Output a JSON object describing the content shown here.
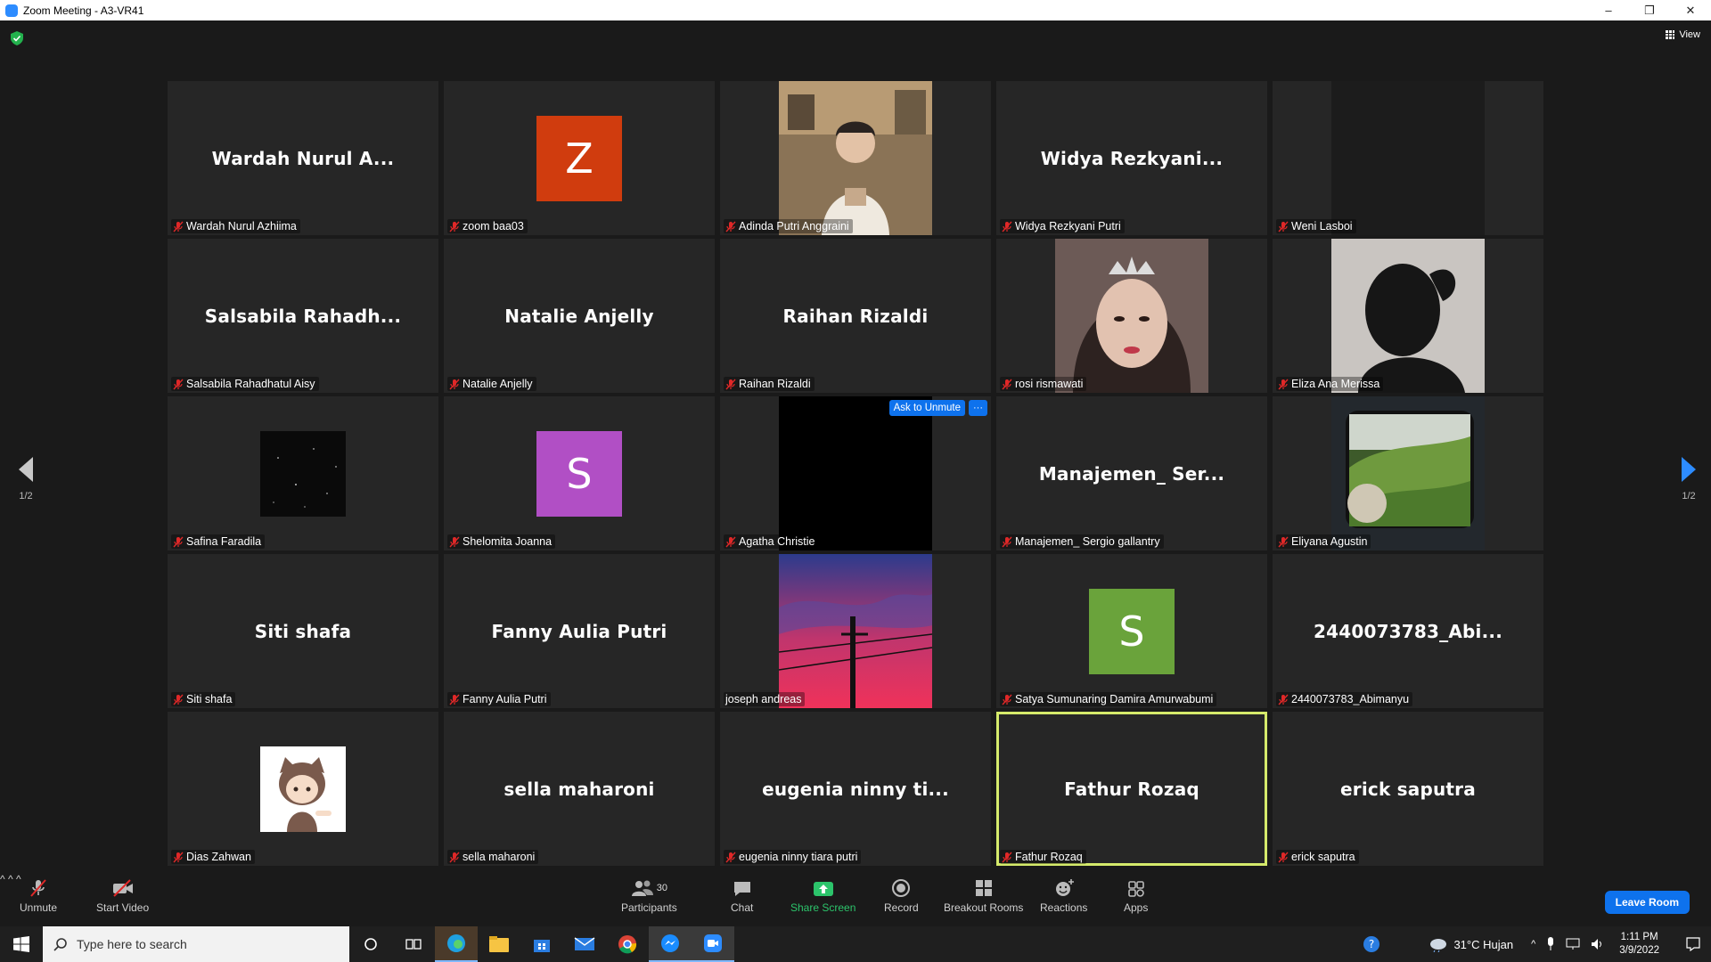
{
  "window": {
    "title": "Zoom Meeting - A3-VR41",
    "controls": [
      "–",
      "❐",
      "✕"
    ]
  },
  "view_button": "View",
  "pager": {
    "left": "1/2",
    "right": "1/2"
  },
  "ask_to_unmute": "Ask to Unmute",
  "more_label": "···",
  "tiles": [
    {
      "label": "Wardah Nurul Azhiima",
      "display": "Wardah Nurul A...",
      "kind": "name"
    },
    {
      "label": "zoom baa03",
      "display": "Z",
      "kind": "avatar",
      "color": "#d03c0e"
    },
    {
      "label": "Adinda Putri Anggraini",
      "kind": "video",
      "video": "room"
    },
    {
      "label": "Widya Rezkyani Putri",
      "display": "Widya Rezkyani...",
      "kind": "name"
    },
    {
      "label": "Weni Lasboi",
      "kind": "video",
      "video": "dark"
    },
    {
      "label": "Salsabila Rahadhatul Aisy",
      "display": "Salsabila Rahadh...",
      "kind": "name"
    },
    {
      "label": "Natalie Anjelly",
      "display": "Natalie Anjelly",
      "kind": "name"
    },
    {
      "label": "Raihan Rizaldi",
      "display": "Raihan Rizaldi",
      "kind": "name"
    },
    {
      "label": "rosi rismawati",
      "kind": "video",
      "video": "girl"
    },
    {
      "label": "Eliza Ana Merissa",
      "kind": "video",
      "video": "silhouette"
    },
    {
      "label": "Safina Faradila",
      "kind": "avatar-img",
      "video": "stars"
    },
    {
      "label": "Shelomita Joanna",
      "display": "S",
      "kind": "avatar",
      "color": "#b14fc5"
    },
    {
      "label": "Agatha Christie",
      "kind": "video",
      "video": "black",
      "ask": true
    },
    {
      "label": "Manajemen_ Sergio gallantry",
      "display": "Manajemen_ Ser...",
      "kind": "name"
    },
    {
      "label": "Eliyana Agustin",
      "kind": "video",
      "video": "landscape"
    },
    {
      "label": "Siti shafa",
      "display": "Siti shafa",
      "kind": "name"
    },
    {
      "label": "Fanny Aulia Putri",
      "display": "Fanny Aulia Putri",
      "kind": "name"
    },
    {
      "label": "joseph andreas",
      "kind": "video",
      "video": "sunset",
      "unmuted": true
    },
    {
      "label": "Satya Sumunaring Damira Amurwabumi",
      "display": "S",
      "kind": "avatar",
      "color": "#6aa33b"
    },
    {
      "label": "2440073783_Abimanyu",
      "display": "2440073783_Abi...",
      "kind": "name"
    },
    {
      "label": "Dias Zahwan",
      "kind": "avatar-img",
      "video": "cartoon"
    },
    {
      "label": "sella maharoni",
      "display": "sella maharoni",
      "kind": "name"
    },
    {
      "label": "eugenia ninny tiara putri",
      "display": "eugenia ninny ti...",
      "kind": "name"
    },
    {
      "label": "Fathur Rozaq",
      "display": "Fathur Rozaq",
      "kind": "name",
      "active": true
    },
    {
      "label": "erick saputra",
      "display": "erick saputra",
      "kind": "name"
    }
  ],
  "toolbar": {
    "unmute": "Unmute",
    "start_video": "Start Video",
    "participants": "Participants",
    "participants_count": "30",
    "chat": "Chat",
    "share_screen": "Share Screen",
    "record": "Record",
    "breakout_rooms": "Breakout Rooms",
    "reactions": "Reactions",
    "apps": "Apps",
    "leave": "Leave Room"
  },
  "taskbar": {
    "search_placeholder": "Type here to search",
    "weather": "31°C  Hujan",
    "time": "1:11 PM",
    "date": "3/9/2022"
  },
  "colors": {
    "accent_blue": "#0e72ed",
    "active_speaker": "#d5ea6b",
    "muted_red": "#e02828",
    "share_green": "#2cc46b"
  }
}
